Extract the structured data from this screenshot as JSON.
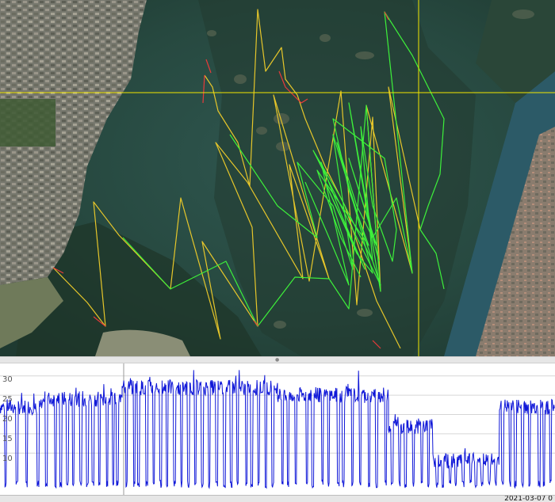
{
  "map": {
    "background": "satellite-imagery",
    "track_colors": {
      "fast": "#3df03a",
      "medium": "#e6c62a",
      "slow": "#e83a3a"
    },
    "crosshair_color": "#f2e600"
  },
  "chart": {
    "line_color": "#1018d8",
    "grid_color": "#d6d6d6",
    "ytick_labels": [
      "30",
      "25",
      "20",
      "15",
      "10"
    ]
  },
  "status": {
    "timestamp": "2021-03-07 0"
  },
  "chart_data": {
    "type": "line",
    "ylim": [
      0,
      32
    ],
    "yticks": [
      10,
      15,
      20,
      25,
      30
    ],
    "grid": true,
    "series": [
      {
        "segments": [
          {
            "x": [
              0,
              0.08
            ],
            "level": 22,
            "dips": 4
          },
          {
            "x": [
              0.08,
              0.22
            ],
            "level": 24,
            "dips": 12
          },
          {
            "x": [
              0.22,
              0.5
            ],
            "level": 27,
            "dips": 22
          },
          {
            "x": [
              0.5,
              0.7
            ],
            "level": 25,
            "dips": 14
          },
          {
            "x": [
              0.7,
              0.78
            ],
            "level": 17,
            "dips": 6
          },
          {
            "x": [
              0.78,
              0.9
            ],
            "level": 8,
            "dips": 10
          },
          {
            "x": [
              0.9,
              1.0
            ],
            "level": 22,
            "dips": 8
          }
        ]
      }
    ]
  }
}
